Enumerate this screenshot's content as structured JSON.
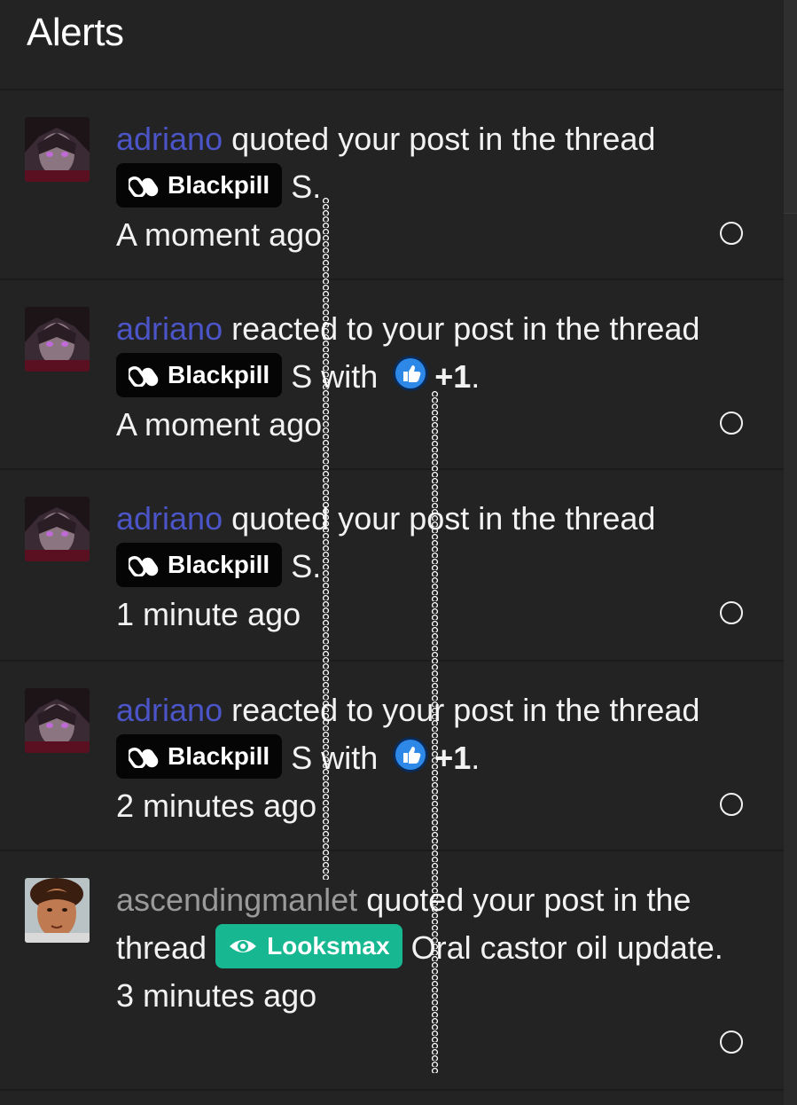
{
  "page": {
    "title": "Alerts"
  },
  "alerts": [
    {
      "user": "adriano",
      "action": " quoted your post in the thread ",
      "prefix": "Blackpill",
      "thread": "S",
      "suffix": ".",
      "time": "A moment ago"
    },
    {
      "user": "adriano",
      "action": " reacted to your post in the thread ",
      "prefix": "Blackpill",
      "thread": "S",
      "with": " with ",
      "reaction": "+1",
      "suffix": ".",
      "time": "A moment ago"
    },
    {
      "user": "adriano",
      "action": " quoted your post in the thread ",
      "prefix": "Blackpill",
      "thread": "S",
      "suffix": ".",
      "time": "1 minute ago"
    },
    {
      "user": "adriano",
      "action": " reacted to your post in the thread ",
      "prefix": "Blackpill",
      "thread": "S",
      "with": " with ",
      "reaction": "+1",
      "suffix": ".",
      "time": "2 minutes ago"
    },
    {
      "user": "ascendingmanlet",
      "action": " quoted your post in the thread ",
      "prefix": "Looksmax",
      "thread": "Oral castor oil update",
      "suffix": ".",
      "time": "3 minutes ago"
    }
  ],
  "colors": {
    "background": "#232323",
    "username": "#4b55c8",
    "username_muted": "#9a9a9a",
    "prefix_blackpill": "#050505",
    "prefix_looksmax": "#17b891",
    "like_reaction": "#2d88e8"
  },
  "icons": {
    "blackpill_prefix": "pills-icon",
    "looksmax_prefix": "eye-icon",
    "reaction": "thumbs-up-icon",
    "read_toggle": "circle-outline-icon"
  }
}
